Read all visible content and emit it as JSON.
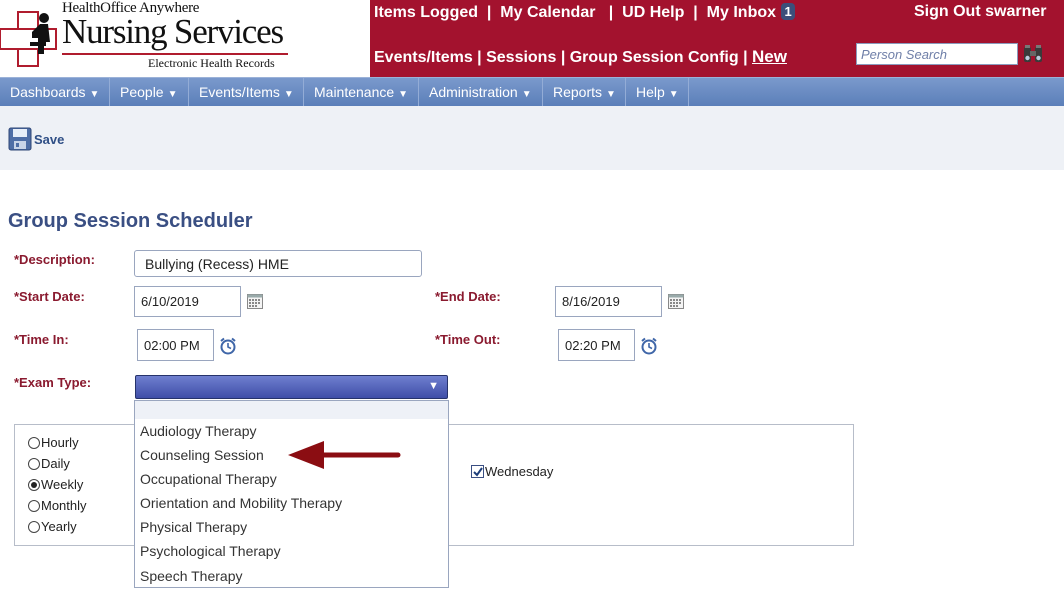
{
  "header": {
    "logo": {
      "top_text": "HealthOffice Anywhere",
      "main_text": "Nursing Services",
      "sub_text": "Electronic Health Records"
    },
    "top_links": [
      "Items Logged",
      "My Calendar",
      "UD Help",
      "My Inbox"
    ],
    "inbox_count": "1",
    "sign_out": "Sign Out swarner",
    "second_links": [
      "Events/Items",
      "Sessions",
      "Group Session Config"
    ],
    "new_link": "New",
    "search_placeholder": "Person Search",
    "colors": {
      "brand": "#a3122e",
      "nav": "#6a8cc3"
    }
  },
  "nav": {
    "items": [
      "Dashboards",
      "People",
      "Events/Items",
      "Maintenance",
      "Administration",
      "Reports",
      "Help"
    ]
  },
  "toolbar": {
    "save_label": "Save"
  },
  "form": {
    "title": "Group Session Scheduler",
    "description_label": "*Description:",
    "description_value": "Bullying  (Recess) HME",
    "start_date_label": "*Start Date:",
    "start_date_value": "6/10/2019",
    "end_date_label": "*End Date:",
    "end_date_value": "8/16/2019",
    "time_in_label": "*Time In:",
    "time_in_value": "02:00 PM",
    "time_out_label": "*Time Out:",
    "time_out_value": "02:20 PM",
    "exam_type_label": "*Exam Type:",
    "exam_type_value": "",
    "exam_type_options": [
      "Audiology Therapy",
      "Counseling Session",
      "Occupational Therapy",
      "Orientation and Mobility Therapy",
      "Physical Therapy",
      "Psychological Therapy",
      "Speech Therapy"
    ]
  },
  "recurrence": {
    "options": [
      "Hourly",
      "Daily",
      "Weekly",
      "Monthly",
      "Yearly"
    ],
    "selected": "Weekly",
    "weekday_label": "Wednesday",
    "weekday_checked": true
  },
  "annotation": {
    "arrow_color": "#8b0d12",
    "points_to": "Counseling Session"
  }
}
